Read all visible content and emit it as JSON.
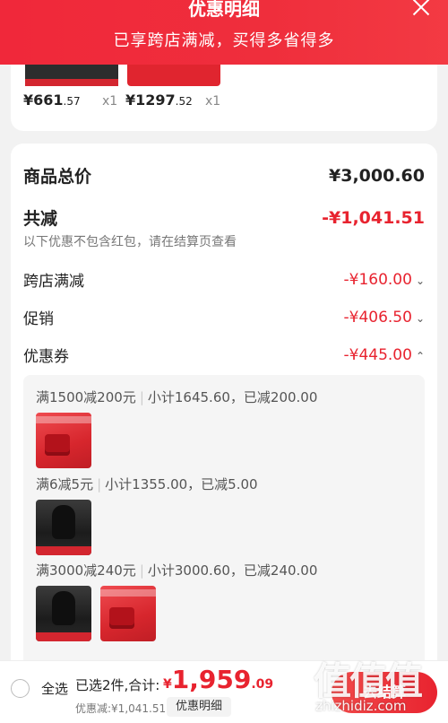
{
  "header": {
    "title": "优惠明细",
    "subtitle": "已享跨店满减，买得多省得多"
  },
  "top_products": [
    {
      "price_int": "¥661",
      "price_dec": ".57",
      "qty": "x1"
    },
    {
      "price_int": "¥1297",
      "price_dec": ".52",
      "qty": "x1"
    }
  ],
  "summary": {
    "total_label": "商品总价",
    "total_value": "¥3,000.60",
    "discount_label": "共减",
    "discount_value": "-¥1,041.51",
    "note": "以下优惠不包含红包，请在结算页查看",
    "items": [
      {
        "label": "跨店满减",
        "value": "-¥160.00"
      },
      {
        "label": "促销",
        "value": "-¥406.50"
      },
      {
        "label": "优惠券",
        "value": "-¥445.00"
      }
    ]
  },
  "coupons": [
    {
      "rule": "满1500减200元",
      "detail": "小计1645.60，已减200.00"
    },
    {
      "rule": "满6减5元",
      "detail": "小计1355.00，已减5.00"
    },
    {
      "rule": "满3000减240元",
      "detail": "小计3000.60，已减240.00"
    }
  ],
  "bottom": {
    "select_all": "全选",
    "selected_text": "已选2件,合计:",
    "total_yen": "¥",
    "total_int": "1,959",
    "total_dec": ".09",
    "discount_line": "优惠减:¥1,041.51",
    "detail_button": "优惠明细",
    "checkout": "去结算"
  },
  "watermark": {
    "site": "zhizhidiz.com"
  },
  "colors": {
    "brand_red": "#e8232f",
    "header_red": "#f0283a"
  }
}
